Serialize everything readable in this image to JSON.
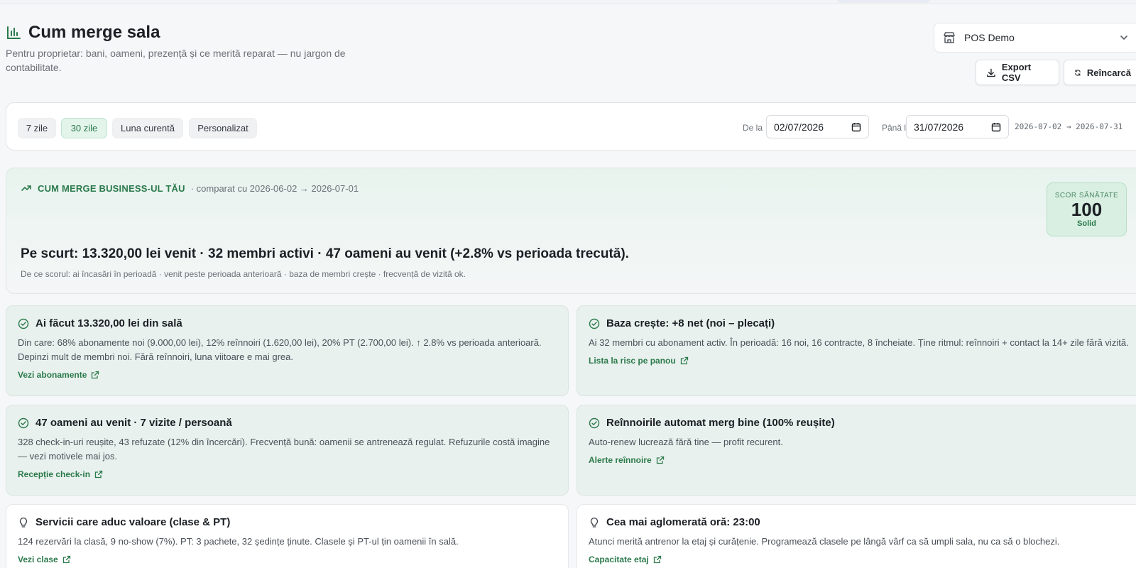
{
  "header": {
    "title": "Cum merge sala",
    "subtitle": "Pentru proprietar: bani, oameni, prezență și ce merită reparat — nu jargon de contabilitate.",
    "title_icon": "bar-chart-icon"
  },
  "toolbar": {
    "pos_selected": "POS Demo",
    "export_label": "Export CSV",
    "reload_label": "Reîncarcă"
  },
  "filters": {
    "presets": [
      "7 zile",
      "30 zile",
      "Luna curentă",
      "Personalizat"
    ],
    "active_preset": "30 zile",
    "from_label": "De la",
    "from_value": "02/07/2026",
    "to_label": "Până la",
    "to_value": "31/07/2026",
    "range_text": "2026-07-02 → 2026-07-31"
  },
  "summary": {
    "label": "CUM MERGE BUSINESS-UL TĂU",
    "compare": "· comparat cu 2026-06-02 → 2026-07-01",
    "main": "Pe scurt: 13.320,00 lei venit · 32 membri activi · 47 oameni au venit (+2.8% vs perioada trecută).",
    "reason": "De ce scorul: ai încasări în perioadă · venit peste perioada anterioară · baza de membri crește · frecvență de vizită ok.",
    "score_label": "SCOR SĂNĂTATE",
    "score_value": "100",
    "score_word": "Solid"
  },
  "cards": [
    {
      "title": "Ai făcut 13.320,00 lei din sală",
      "body": "Din care: 68% abonamente noi (9.000,00 lei), 12% reînnoiri (1.620,00 lei), 20% PT (2.700,00 lei). ↑ 2.8% vs perioada anterioară. Depinzi mult de membri noi. Fără reînnoiri, luna viitoare e mai grea.",
      "link": "Vezi abonamente",
      "icon": "check-circle-icon"
    },
    {
      "title": "Baza crește: +8 net (noi – plecați)",
      "body": "Ai 32 membri cu abonament activ. În perioadă: 16 noi, 16 contracte, 8 încheiate. Ține ritmul: reînnoiri + contact la 14+ zile fără vizită.",
      "link": "Lista la risc pe panou",
      "icon": "check-circle-icon"
    },
    {
      "title": "47 oameni au venit · 7 vizite / persoană",
      "body": "328 check-in-uri reușite, 43 refuzate (12% din încercări). Frecvență bună: oamenii se antrenează regulat. Refuzurile costă imagine — vezi motivele mai jos.",
      "link": "Recepție check-in",
      "icon": "check-circle-icon"
    },
    {
      "title": "Reînnoirile automat merg bine (100% reușite)",
      "body": "Auto-renew lucrează fără tine — profit recurent.",
      "link": "Alerte reînnoire",
      "icon": "check-circle-icon"
    },
    {
      "title": "Servicii care aduc valoare (clase & PT)",
      "body": "124 rezervări la clasă, 9 no-show (7%). PT: 3 pachete, 32 ședințe ținute. Clasele și PT-ul țin oamenii în sală.",
      "link": "Vezi clase",
      "icon": "lightbulb-icon"
    },
    {
      "title": "Cea mai aglomerată oră: 23:00",
      "body": "Atunci merită antrenor la etaj și curățenie. Programează clasele pe lângă vârf ca să umpli sala, nu ca să o blochezi.",
      "link": "Capacitate etaj",
      "icon": "lightbulb-icon"
    }
  ],
  "colors": {
    "accent": "#2b7a4b",
    "card_positive_bg": "#e9f1ee",
    "score_bg": "#d8efe2"
  }
}
